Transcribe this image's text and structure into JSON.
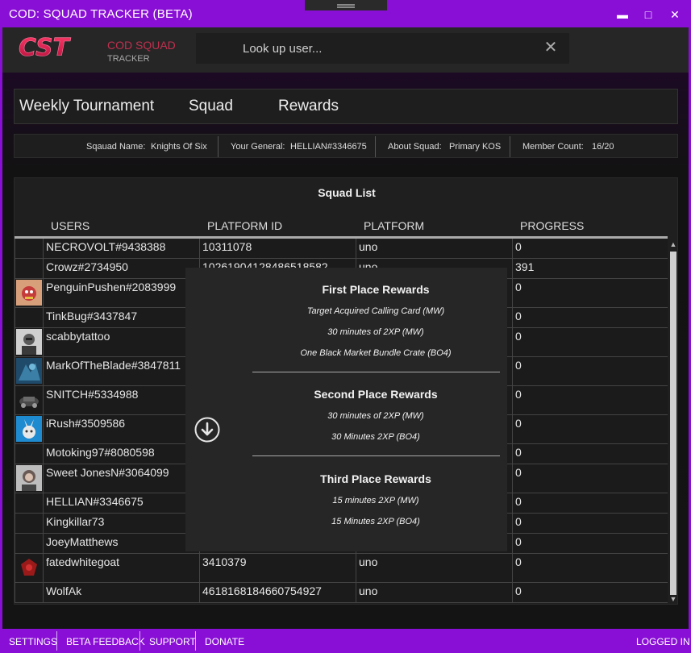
{
  "window": {
    "title": "COD: SQUAD TRACKER (BETA)",
    "minimize": "▬",
    "maximize": "□",
    "close": "✕"
  },
  "header": {
    "logo_text": "CST",
    "brand_line1": "COD SQUAD",
    "brand_line2": "TRACKER",
    "search_placeholder": "Look up user...",
    "search_clear": "✕"
  },
  "nav": {
    "tabs": [
      {
        "label": "Weekly Tournament"
      },
      {
        "label": "Squad"
      },
      {
        "label": "Rewards"
      }
    ]
  },
  "squad_info": {
    "name_label": "Sqauad Name:",
    "name_value": "Knights Of Six",
    "general_label": "Your General:",
    "general_value": "HELLIAN#3346675",
    "about_label": "About Squad:",
    "about_value": "Primary KOS",
    "count_label": "Member Count:",
    "count_value": "16/20"
  },
  "squad_list": {
    "title": "Squad List",
    "columns": [
      "USERS",
      "PLATFORM ID",
      "PLATFORM",
      "PROGRESS"
    ],
    "rows": [
      {
        "user": "NECROVOLT#9438388",
        "platform_id": "10311078",
        "platform": "uno",
        "progress": "0",
        "avatar": ""
      },
      {
        "user": "Crowz#2734950",
        "platform_id": "10261904128486518582",
        "platform": "uno",
        "progress": "391",
        "avatar": ""
      },
      {
        "user": "PenguinPushen#2083999",
        "platform_id": "",
        "platform": "",
        "progress": "0",
        "avatar": "penguin-avatar"
      },
      {
        "user": "TinkBug#3437847",
        "platform_id": "",
        "platform": "",
        "progress": "0",
        "avatar": ""
      },
      {
        "user": "scabbytattoo",
        "platform_id": "",
        "platform": "",
        "progress": "0",
        "avatar": "portrait-avatar"
      },
      {
        "user": "MarkOfTheBlade#3847811",
        "platform_id": "",
        "platform": "",
        "progress": "0",
        "avatar": "blue-art-avatar"
      },
      {
        "user": "SNITCH#5334988",
        "platform_id": "",
        "platform": "",
        "progress": "0",
        "avatar": "vehicle-avatar"
      },
      {
        "user": "iRush#3509586",
        "platform_id": "",
        "platform": "",
        "progress": "0",
        "avatar": "rabbit-avatar"
      },
      {
        "user": "Motoking97#8080598",
        "platform_id": "",
        "platform": "",
        "progress": "0",
        "avatar": ""
      },
      {
        "user": "Sweet JonesN#3064099",
        "platform_id": "",
        "platform": "",
        "progress": "0",
        "avatar": "woman-avatar"
      },
      {
        "user": "HELLIAN#3346675",
        "platform_id": "",
        "platform": "",
        "progress": "0",
        "avatar": ""
      },
      {
        "user": "Kingkillar73",
        "platform_id": "",
        "platform": "",
        "progress": "0",
        "avatar": ""
      },
      {
        "user": "JoeyMatthews",
        "platform_id": "",
        "platform": "",
        "progress": "0",
        "avatar": ""
      },
      {
        "user": "fatedwhitegoat",
        "platform_id": "3410379",
        "platform": "uno",
        "progress": "0",
        "avatar": "red-emblem-avatar"
      },
      {
        "user": "WolfAk",
        "platform_id": "4618168184660754927",
        "platform": "uno",
        "progress": "0",
        "avatar": ""
      }
    ]
  },
  "rewards_overlay": {
    "sections": [
      {
        "title": "First Place Rewards",
        "items": [
          "Target Acquired Calling Card (MW)",
          "30 minutes of 2XP (MW)",
          "One Black Market Bundle Crate (BO4)"
        ]
      },
      {
        "title": "Second Place Rewards",
        "items": [
          "30 minutes of 2XP (MW)",
          "30 Minutes 2XP   (BO4)"
        ]
      },
      {
        "title": "Third Place Rewards",
        "items": [
          "15 minutes 2XP   (MW)",
          "15 Minutes 2XP   (BO4)"
        ]
      }
    ]
  },
  "footer": {
    "links": [
      "SETTINGS",
      "BETA FEEDBACK",
      "SUPPORT",
      "DONATE"
    ],
    "status": "LOGGED IN"
  },
  "colors": {
    "accent": "#8a0fd6",
    "brand_red": "#c0304f"
  }
}
